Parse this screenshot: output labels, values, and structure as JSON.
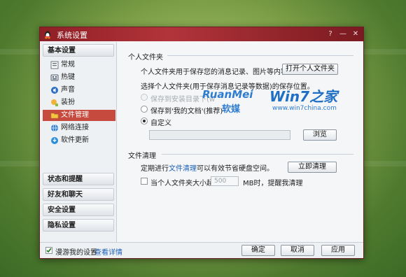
{
  "window": {
    "title": "系统设置",
    "help_symbol": "?",
    "min_symbol": "—",
    "close_symbol": "✕"
  },
  "sidebar": {
    "header": "基本设置",
    "items": [
      {
        "label": "常规",
        "icon": "general-icon"
      },
      {
        "label": "热键",
        "icon": "keyboard-icon"
      },
      {
        "label": "声音",
        "icon": "speaker-icon"
      },
      {
        "label": "装扮",
        "icon": "skin-icon"
      },
      {
        "label": "文件管理",
        "icon": "folder-icon",
        "active": true
      },
      {
        "label": "网络连接",
        "icon": "network-icon"
      },
      {
        "label": "软件更新",
        "icon": "update-icon"
      }
    ],
    "categories": [
      "状态和提醒",
      "好友和聊天",
      "安全设置",
      "隐私设置"
    ]
  },
  "personal_folder": {
    "section_title": "个人文件夹",
    "description": "个人文件夹用于保存您的消息记录、图片等内容。",
    "open_button": "打开个人文件夹",
    "choose_label": "选择个人文件夹(用于保存消息记录等数据)的保存位置。",
    "options": [
      {
        "label": "保存到安装目录下(w",
        "state": "disabled"
      },
      {
        "label": "保存到'我的文档'(推荐)",
        "state": "unchecked"
      },
      {
        "label": "自定义",
        "state": "checked"
      }
    ],
    "custom_path": "",
    "browse_button": "浏览"
  },
  "file_cleanup": {
    "section_title": "文件清理",
    "text_prefix": "定期进行",
    "link_text": "文件清理",
    "text_suffix": "可以有效节省硬盘空间。",
    "clean_button": "立即清理",
    "threshold_label_prefix": "当个人文件夹大小超过",
    "threshold_value": "500",
    "threshold_label_suffix": "MB时，提醒我清理",
    "threshold_checked": false
  },
  "footer": {
    "roaming_label": "漫游我的设置",
    "details_link": "查看详情",
    "ok_button": "确定",
    "cancel_button": "取消",
    "apply_button": "应用"
  },
  "watermark": {
    "brand_latin": "RuanMei",
    "brand_cn": "软媒",
    "logo_text": "Win7之家",
    "url": "www.win7china.com"
  },
  "colors": {
    "titlebar": "#9e2a30",
    "active_item": "#c64a3e",
    "link": "#1c5fb5"
  }
}
